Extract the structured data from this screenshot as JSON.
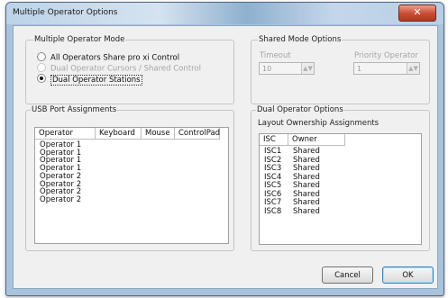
{
  "window": {
    "title": "Multiple Operator Options",
    "close_glyph": "✕"
  },
  "mode_group": {
    "label": "Multiple Operator Mode",
    "options": [
      {
        "label": "All Operators Share pro xi Control",
        "selected": false,
        "enabled": true
      },
      {
        "label": "Dual Operator Cursors / Shared Control",
        "selected": false,
        "enabled": false
      },
      {
        "label": "Dual Operator Stations",
        "selected": true,
        "enabled": true
      }
    ]
  },
  "shared_group": {
    "label": "Shared Mode Options",
    "timeout_label": "Timeout",
    "timeout_value": "10",
    "priority_label": "Priority Operator",
    "priority_value": "1"
  },
  "usb_group": {
    "label": "USB Port Assignments",
    "columns": [
      "Operator",
      "Keyboard",
      "Mouse",
      "ControlPad"
    ],
    "rows": [
      "Operator 1",
      "Operator 1",
      "Operator 1",
      "Operator 1",
      "Operator 2",
      "Operator 2",
      "Operator 2",
      "Operator 2"
    ]
  },
  "dual_group": {
    "label": "Dual Operator Options",
    "sublabel": "Layout Ownership Assignments",
    "columns": [
      "ISC",
      "Owner"
    ],
    "rows": [
      {
        "isc": "ISC1",
        "owner": "Shared"
      },
      {
        "isc": "ISC2",
        "owner": "Shared"
      },
      {
        "isc": "ISC3",
        "owner": "Shared"
      },
      {
        "isc": "ISC4",
        "owner": "Shared"
      },
      {
        "isc": "ISC5",
        "owner": "Shared"
      },
      {
        "isc": "ISC6",
        "owner": "Shared"
      },
      {
        "isc": "ISC7",
        "owner": "Shared"
      },
      {
        "isc": "ISC8",
        "owner": "Shared"
      }
    ]
  },
  "buttons": {
    "cancel": "Cancel",
    "ok": "OK"
  }
}
